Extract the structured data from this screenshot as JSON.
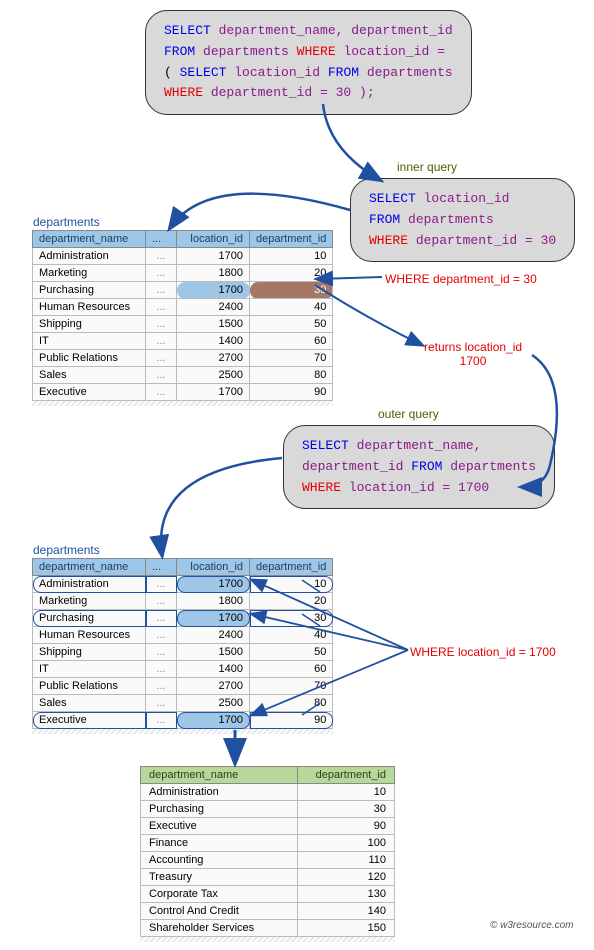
{
  "top_sql": {
    "l1_select": "SELECT ",
    "l1_cols": "department_name, department_id",
    "l2_from": "FROM ",
    "l2_tbl": "departments ",
    "l2_where": "WHERE ",
    "l2_cond": "location_id =",
    "l3_open": "( ",
    "l3_select": "SELECT ",
    "l3_col": "location_id ",
    "l3_from": "FROM  ",
    "l3_tbl": "departments",
    "l4_where": "WHERE ",
    "l4_cond": "department_id = 30 );"
  },
  "inner_label": "inner query",
  "inner_sql": {
    "l1_select": "SELECT ",
    "l1_col": "location_id",
    "l2_from": "FROM  ",
    "l2_tbl": "departments",
    "l3_where": "WHERE ",
    "l3_cond": "department_id = 30"
  },
  "inner_annot": "WHERE department_id = 30",
  "returns_label_a": "returns location_id",
  "returns_label_b": "1700",
  "departments_label": "departments",
  "thead": {
    "name": "department_name",
    "loc": "location_id",
    "dept": "department_id"
  },
  "departments_rows": [
    {
      "name": "Administration",
      "loc": "1700",
      "dept": "10"
    },
    {
      "name": "Marketing",
      "loc": "1800",
      "dept": "20"
    },
    {
      "name": "Purchasing",
      "loc": "1700",
      "dept": "30"
    },
    {
      "name": "Human Resources",
      "loc": "2400",
      "dept": "40"
    },
    {
      "name": "Shipping",
      "loc": "1500",
      "dept": "50"
    },
    {
      "name": "IT",
      "loc": "1400",
      "dept": "60"
    },
    {
      "name": "Public Relations",
      "loc": "2700",
      "dept": "70"
    },
    {
      "name": "Sales",
      "loc": "2500",
      "dept": "80"
    },
    {
      "name": "Executive",
      "loc": "1700",
      "dept": "90"
    }
  ],
  "outer_label": "outer query",
  "outer_sql": {
    "l1_select": "SELECT ",
    "l1_col": "department_name,",
    "l2_col": "department_id ",
    "l2_from": "FROM ",
    "l2_tbl": "departments",
    "l3_where": "WHERE ",
    "l3_cond": "location_id = 1700"
  },
  "outer_annot": "WHERE location_id = 1700",
  "result_head": {
    "name": "department_name",
    "dept": "department_id"
  },
  "result_rows": [
    {
      "name": "Administration",
      "dept": "10"
    },
    {
      "name": "Purchasing",
      "dept": "30"
    },
    {
      "name": "Executive",
      "dept": "90"
    },
    {
      "name": "Finance",
      "dept": "100"
    },
    {
      "name": "Accounting",
      "dept": "110"
    },
    {
      "name": "Treasury",
      "dept": "120"
    },
    {
      "name": "Corporate Tax",
      "dept": "130"
    },
    {
      "name": "Control And Credit",
      "dept": "140"
    },
    {
      "name": "Shareholder Services",
      "dept": "150"
    }
  ],
  "credit": "© w3resource.com"
}
